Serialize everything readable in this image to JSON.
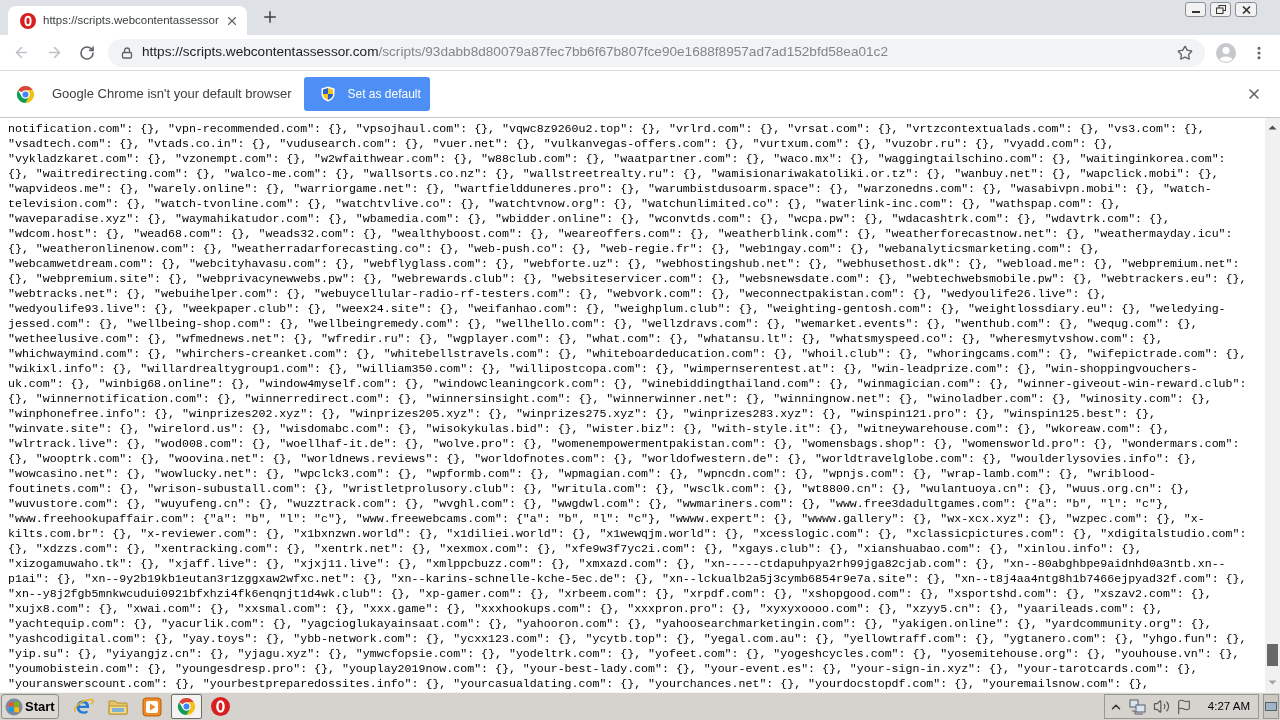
{
  "tabs": [
    {
      "title": "https://scripts.webcontentassessor",
      "selected": true
    }
  ],
  "toolbar": {
    "nav_buttons": [
      {
        "kind": "back",
        "disabled": true
      },
      {
        "kind": "forward",
        "disabled": true
      },
      {
        "kind": "reload",
        "disabled": false
      }
    ],
    "url_host": "https://scripts.webcontentassessor.com",
    "url_path": "/scripts/93dabb8d80079a87fec7bb6f67b807fce90e1688f8957ad7ad152bfd58ea01c2"
  },
  "infobar": {
    "message": "Google Chrome isn't your default browser",
    "button": "Set as default"
  },
  "page": {
    "lines": [
      "notification.com\": {}, \"vpn-recommended.com\": {}, \"vpsojhaul.com\": {}, \"vqwc8z9260u2.top\": {}, \"vrlrd.com\": {}, \"vrsat.com\": {}, \"vrtzcontextualads.com\": {}, \"vs3.com\": {},",
      "\"vsadtech.com\": {}, \"vtads.co.in\": {}, \"vudusearch.com\": {}, \"vuer.net\": {}, \"vulkanvegas-offers.com\": {}, \"vurtxum.com\": {}, \"vuzobr.ru\": {}, \"vyadd.com\": {},",
      "\"vykladzkaret.com\": {}, \"vzonempt.com\": {}, \"w2wfaithwear.com\": {}, \"w88club.com\": {}, \"waatpartner.com\": {}, \"waco.mx\": {}, \"waggingtailschino.com\": {}, \"waitinginkorea.com\":",
      "{}, \"waitredirecting.com\": {}, \"walco-me.com\": {}, \"wallsorts.co.nz\": {}, \"wallstreetrealty.ru\": {}, \"wamisionariwakatoliki.or.tz\": {}, \"wanbuy.net\": {}, \"wapclick.mobi\": {},",
      "\"wapvideos.me\": {}, \"warely.online\": {}, \"warriorgame.net\": {}, \"wartfieldduneres.pro\": {}, \"warumbistdusoarm.space\": {}, \"warzonedns.com\": {}, \"wasabivpn.mobi\": {}, \"watch-",
      "television.com\": {}, \"watch-tvonline.com\": {}, \"watchtvlive.co\": {}, \"watchtvnow.org\": {}, \"watchunlimited.co\": {}, \"waterlink-inc.com\": {}, \"wathspap.com\": {},",
      "\"waveparadise.xyz\": {}, \"waymahikatudor.com\": {}, \"wbamedia.com\": {}, \"wbidder.online\": {}, \"wconvtds.com\": {}, \"wcpa.pw\": {}, \"wdacashtrk.com\": {}, \"wdavtrk.com\": {},",
      "\"wdcom.host\": {}, \"wead68.com\": {}, \"weads32.com\": {}, \"wealthyboost.com\": {}, \"weareoffers.com\": {}, \"weatherblink.com\": {}, \"weatherforecastnow.net\": {}, \"weathermayday.icu\":",
      "{}, \"weatheronlinenow.com\": {}, \"weatherradarforecasting.co\": {}, \"web-push.co\": {}, \"web-regie.fr\": {}, \"web1ngay.com\": {}, \"webanalyticsmarketing.com\": {},",
      "\"webcamwetdream.com\": {}, \"webcityhavasu.com\": {}, \"webflyglass.com\": {}, \"webforte.uz\": {}, \"webhostingshub.net\": {}, \"webhusethost.dk\": {}, \"webload.me\": {}, \"webpremium.net\":",
      "{}, \"webpremium.site\": {}, \"webprivacynewwebs.pw\": {}, \"webrewards.club\": {}, \"websiteservicer.com\": {}, \"websnewsdate.com\": {}, \"webtechwebsmobile.pw\": {}, \"webtrackers.eu\": {},",
      "\"webtracks.net\": {}, \"webuihelper.com\": {}, \"webuycellular-radio-rf-testers.com\": {}, \"webvork.com\": {}, \"weconnectpakistan.com\": {}, \"wedyoulife26.live\": {},",
      "\"wedyoulife93.live\": {}, \"weekpaper.club\": {}, \"weex24.site\": {}, \"weifanhao.com\": {}, \"weighplum.club\": {}, \"weighting-gentosh.com\": {}, \"weightlossdiary.eu\": {}, \"weledying-",
      "jessed.com\": {}, \"wellbeing-shop.com\": {}, \"wellbeingremedy.com\": {}, \"wellhello.com\": {}, \"wellzdravs.com\": {}, \"wemarket.events\": {}, \"wenthub.com\": {}, \"wequg.com\": {},",
      "\"wetheelusive.com\": {}, \"wfmednews.net\": {}, \"wfredir.ru\": {}, \"wgplayer.com\": {}, \"what.com\": {}, \"whatansu.lt\": {}, \"whatsmyspeed.co\": {}, \"wheresmytvshow.com\": {},",
      "\"whichwaymind.com\": {}, \"whirchers-creanket.com\": {}, \"whitebellstravels.com\": {}, \"whiteboardeducation.com\": {}, \"whoil.club\": {}, \"whoringcams.com\": {}, \"wifepictrade.com\": {},",
      "\"wikixl.info\": {}, \"willardrealtygroup1.com\": {}, \"william350.com\": {}, \"willipostcopa.com\": {}, \"wimpernserentest.at\": {}, \"win-leadprize.com\": {}, \"win-shoppingvouchers-",
      "uk.com\": {}, \"winbig68.online\": {}, \"window4myself.com\": {}, \"windowcleaningcork.com\": {}, \"winebiddingthailand.com\": {}, \"winmagician.com\": {}, \"winner-giveout-win-reward.club\":",
      "{}, \"winnernotification.com\": {}, \"winnerredirect.com\": {}, \"winnersinsight.com\": {}, \"winnerwinner.net\": {}, \"winningnow.net\": {}, \"winoladber.com\": {}, \"winosity.com\": {},",
      "\"winphonefree.info\": {}, \"winprizes202.xyz\": {}, \"winprizes205.xyz\": {}, \"winprizes275.xyz\": {}, \"winprizes283.xyz\": {}, \"winspin121.pro\": {}, \"winspin125.best\": {},",
      "\"winvate.site\": {}, \"wirelord.us\": {}, \"wisdomabc.com\": {}, \"wisokykulas.bid\": {}, \"wister.biz\": {}, \"with-style.it\": {}, \"witneywarehouse.com\": {}, \"wkoreaw.com\": {},",
      "\"wlrtrack.live\": {}, \"wod008.com\": {}, \"woellhaf-it.de\": {}, \"wolve.pro\": {}, \"womenempowermentpakistan.com\": {}, \"womensbags.shop\": {}, \"womensworld.pro\": {}, \"wondermars.com\":",
      "{}, \"wooptrk.com\": {}, \"woovina.net\": {}, \"worldnews.reviews\": {}, \"worldofnotes.com\": {}, \"worldofwestern.de\": {}, \"worldtravelglobe.com\": {}, \"woulderlysovies.info\": {},",
      "\"wowcasino.net\": {}, \"wowlucky.net\": {}, \"wpclck3.com\": {}, \"wpformb.com\": {}, \"wpmagian.com\": {}, \"wpncdn.com\": {}, \"wpnjs.com\": {}, \"wrap-lamb.com\": {}, \"wriblood-",
      "foutinets.com\": {}, \"wrison-subustall.com\": {}, \"wristletprolusory.club\": {}, \"writula.com\": {}, \"wsclk.com\": {}, \"wt8800.cn\": {}, \"wulantuoya.cn\": {}, \"wuus.org.cn\": {},",
      "\"wuvustore.com\": {}, \"wuyufeng.cn\": {}, \"wuzztrack.com\": {}, \"wvghl.com\": {}, \"wwgdwl.com\": {}, \"wwmariners.com\": {}, \"www.free3dadultgames.com\": {\"a\": \"b\", \"l\": \"c\"},",
      "\"www.freehookupaffair.com\": {\"a\": \"b\", \"l\": \"c\"}, \"www.freewebcams.com\": {\"a\": \"b\", \"l\": \"c\"}, \"wwww.expert\": {}, \"wwww.gallery\": {}, \"wx-xcx.xyz\": {}, \"wzpec.com\": {}, \"x-",
      "kilts.com.br\": {}, \"x-reviewer.com\": {}, \"x1bxnzwn.world\": {}, \"x1diliei.world\": {}, \"x1wewqjm.world\": {}, \"xcesslogic.com\": {}, \"xclassicpictures.com\": {}, \"xdigitalstudio.com\":",
      "{}, \"xdzzs.com\": {}, \"xentracking.com\": {}, \"xentrk.net\": {}, \"xexmox.com\": {}, \"xfe9w3f7yc2i.com\": {}, \"xgays.club\": {}, \"xianshuabao.com\": {}, \"xinlou.info\": {},",
      "\"xizogamuwaho.tk\": {}, \"xjaff.live\": {}, \"xjxj11.live\": {}, \"xmlppcbuzz.com\": {}, \"xmxazd.com\": {}, \"xn-----ctdapuhpya2rh99jga82cjab.com\": {}, \"xn--80abghbpe9aidnhd0a3ntb.xn--",
      "p1ai\": {}, \"xn--9y2b19kb1eutan3r1zggxaw2wfxc.net\": {}, \"xn--karins-schnelle-kche-5ec.de\": {}, \"xn--lckualb2a5j3cymb6854r9e7a.site\": {}, \"xn--t8j4aa4ntg8h1b7466ejpyad32f.com\": {},",
      "\"xn--y8j2fgb5mnkwcudui0921bfxhzi4fk6enqnjt1d4wk.club\": {}, \"xp-gamer.com\": {}, \"xrbeem.com\": {}, \"xrpdf.com\": {}, \"xshopgood.com\": {}, \"xsportshd.com\": {}, \"xszav2.com\": {},",
      "\"xujx8.com\": {}, \"xwai.com\": {}, \"xxsmal.com\": {}, \"xxx.game\": {}, \"xxxhookups.com\": {}, \"xxxpron.pro\": {}, \"xyxyxoooo.com\": {}, \"xzyy5.cn\": {}, \"yaarileads.com\": {},",
      "\"yachtequip.com\": {}, \"yacurlik.com\": {}, \"yagcioglukayainsaat.com\": {}, \"yahooron.com\": {}, \"yahoosearchmarketingin.com\": {}, \"yakigen.online\": {}, \"yardcommunity.org\": {},",
      "\"yashcodigital.com\": {}, \"yay.toys\": {}, \"ybb-network.com\": {}, \"ycxx123.com\": {}, \"ycytb.top\": {}, \"yegal.com.au\": {}, \"yellowtraff.com\": {}, \"ygtanero.com\": {}, \"yhgo.fun\": {},",
      "\"yip.su\": {}, \"yiyangjz.cn\": {}, \"yjagu.xyz\": {}, \"ymwcfopsie.com\": {}, \"yodeltrk.com\": {}, \"yofeet.com\": {}, \"yogeshcycles.com\": {}, \"yosemitehouse.org\": {}, \"youhouse.vn\": {},",
      "\"youmobistein.com\": {}, \"youngesdresp.pro\": {}, \"youplay2019now.com\": {}, \"your-best-lady.com\": {}, \"your-event.es\": {}, \"your-sign-in.xyz\": {}, \"your-tarotcards.com\": {},",
      "\"youranswerscount.com\": {}, \"yourbestpreparedossites.info\": {}, \"yourcasualdating.com\": {}, \"yourchances.net\": {}, \"yourdocstopdf.com\": {}, \"youremailsnow.com\": {},"
    ]
  },
  "taskbar": {
    "start": "Start",
    "apps": [
      {
        "kind": "ie",
        "selected": false
      },
      {
        "kind": "folder",
        "selected": false
      },
      {
        "kind": "media",
        "selected": false
      },
      {
        "kind": "chrome",
        "selected": true
      },
      {
        "kind": "ring",
        "selected": false
      }
    ],
    "clock": "4:27 AM"
  }
}
